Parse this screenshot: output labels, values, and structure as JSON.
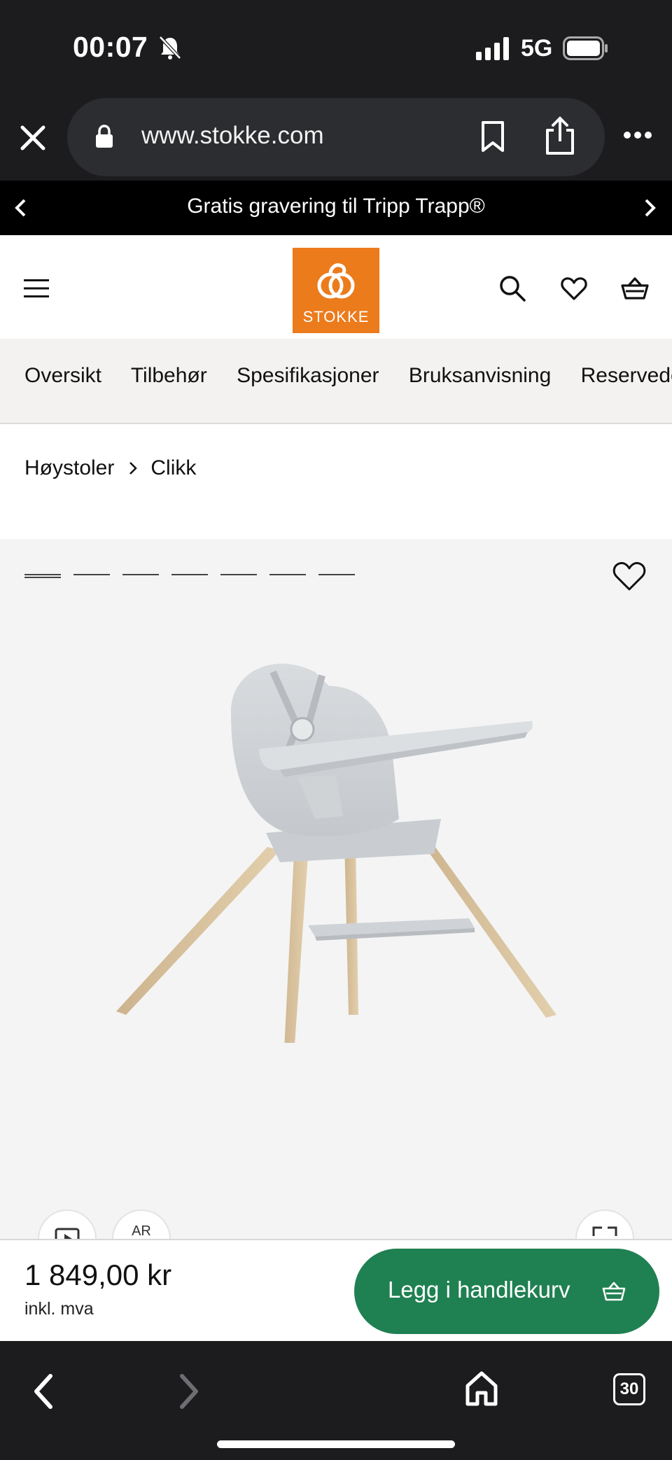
{
  "status_bar": {
    "time": "00:07",
    "network": "5G"
  },
  "browser": {
    "url": "www.stokke.com",
    "tab_count": "30"
  },
  "promo": {
    "text": "Gratis gravering til Tripp Trapp®"
  },
  "logo": {
    "text": "STOKKE"
  },
  "subnav": {
    "items": [
      "Oversikt",
      "Tilbehør",
      "Spesifikasjoner",
      "Bruksanvisning",
      "Reservedeler"
    ]
  },
  "breadcrumb": {
    "items": [
      "Høystoler",
      "Clikk"
    ]
  },
  "gallery": {
    "image_count": 7,
    "active_index": 0,
    "ar_label": "AR"
  },
  "purchase": {
    "price": "1 849,00 kr",
    "vat_note": "inkl. mva",
    "cart_label": "Legg i handlekurv"
  },
  "colors": {
    "accent_green": "#1f8051",
    "brand_orange": "#ec7b1c",
    "chrome_dark": "#1c1c1e"
  },
  "icons": [
    "bell-slash-icon",
    "signal-icon",
    "battery-icon",
    "close-icon",
    "lock-icon",
    "bookmark-icon",
    "share-icon",
    "more-icon",
    "chevron-left-icon",
    "chevron-right-icon",
    "menu-icon",
    "search-icon",
    "heart-icon",
    "basket-icon",
    "play-icon",
    "ar-icon",
    "expand-icon",
    "home-icon",
    "tabs-icon"
  ]
}
